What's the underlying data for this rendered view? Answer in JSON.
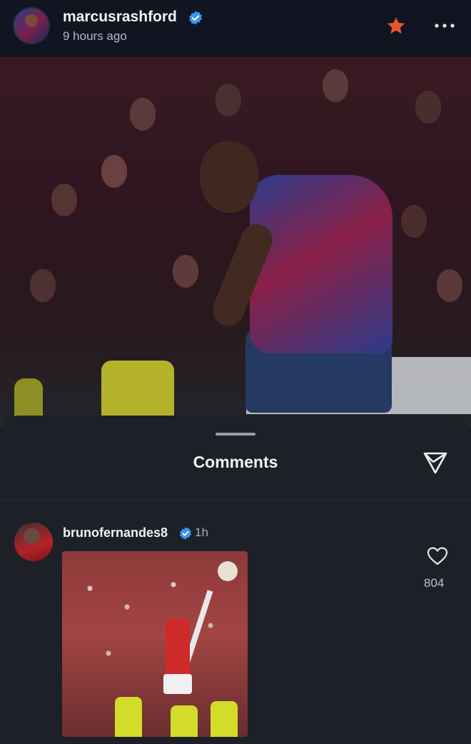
{
  "post": {
    "username": "marcusrashford",
    "time_ago": "9 hours ago",
    "verified": true,
    "favorite_color": "#e8562a"
  },
  "comments_sheet": {
    "title": "Comments"
  },
  "comment": {
    "username": "brunofernandes8",
    "time": "1h",
    "like_count": "804",
    "verified": true
  },
  "icons": {
    "star": "star-icon",
    "more": "more-horizontal-icon",
    "share": "send-icon",
    "like": "heart-icon",
    "verified": "verified-badge-icon"
  }
}
